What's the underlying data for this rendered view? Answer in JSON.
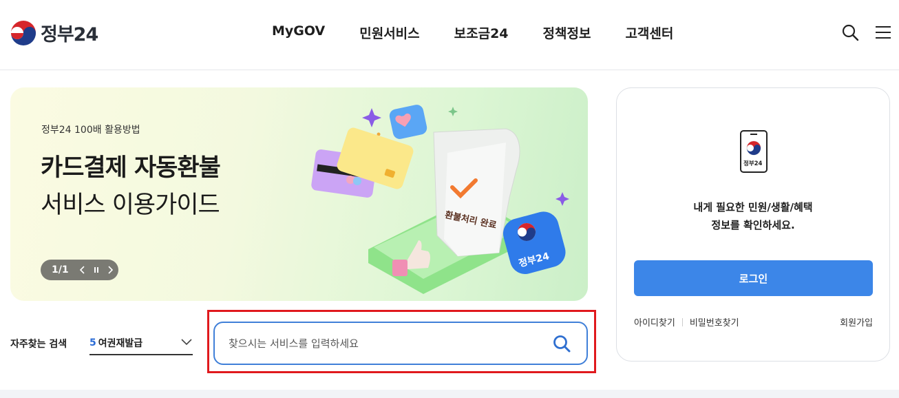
{
  "header": {
    "logo_text": "정부24",
    "nav": [
      "MyGOV",
      "민원서비스",
      "보조금24",
      "정책정보",
      "고객센터"
    ],
    "icons": [
      "search-icon",
      "hamburger-menu-icon"
    ]
  },
  "banner": {
    "subtitle": "정부24 100배 활용방법",
    "title_bold": "카드결제 자동환불",
    "title_light": "서비스 이용가이드",
    "art_receipt_text": "환불처리 완료",
    "art_badge_text": "정부24",
    "pagination": "1/1",
    "controls": [
      "prev-icon",
      "pause-icon",
      "next-icon"
    ]
  },
  "frequent_search": {
    "label": "자주찾는 검색",
    "selected_number": "5",
    "selected_text": "여권재발급"
  },
  "search": {
    "placeholder": "찾으시는 서비스를 입력하세요"
  },
  "login_card": {
    "phone_label": "정부24",
    "message_line1": "내게 필요한 민원/생활/혜택",
    "message_line2": "정보를 확인하세요.",
    "login_button": "로그인",
    "find_id": "아이디찾기",
    "find_password": "비밀번호찾기",
    "signup": "회원가입"
  },
  "colors": {
    "primary_blue": "#3c86e8",
    "search_border": "#3f7fd8",
    "highlight_red": "#e0191d",
    "banner_bg": "#e6f6d8"
  }
}
